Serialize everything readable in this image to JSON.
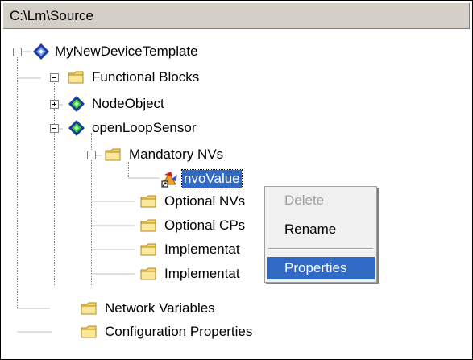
{
  "title_bar": {
    "path": "C:\\Lm\\Source"
  },
  "tree": {
    "root": "MyNewDeviceTemplate",
    "functional_blocks": "Functional Blocks",
    "node_object": "NodeObject",
    "open_loop_sensor": "openLoopSensor",
    "mandatory_nvs": "Mandatory NVs",
    "nvo_value": "nvoValue",
    "optional_nvs": "Optional NVs",
    "optional_cps": "Optional CPs",
    "implementation_1": "Implementat",
    "implementation_2": "Implementat",
    "network_variables": "Network Variables",
    "configuration_properties": "Configuration Properties"
  },
  "context_menu": {
    "delete": "Delete",
    "rename": "Rename",
    "properties": "Properties"
  },
  "colors": {
    "selection": "#316ac5",
    "folder": "#f5d76e",
    "device_diamond": "#1e3a9e",
    "block_diamond": "#2e9e2e"
  }
}
